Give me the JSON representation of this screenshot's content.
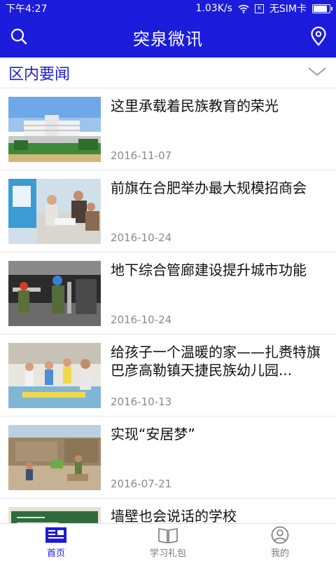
{
  "status_bar": {
    "time": "下午4:27",
    "speed": "1.03K/s",
    "sim": "无SIM卡",
    "sim_box": "×",
    "battery_level": 0.9
  },
  "app_bar": {
    "title": "突泉微讯",
    "left_icon": "search-icon",
    "right_icon": "location-icon"
  },
  "section": {
    "title": "区内要闻",
    "toggle_icon": "chevron-down-icon"
  },
  "news": [
    {
      "title": "这里承载着民族教育的荣光",
      "date": "2016-11-07"
    },
    {
      "title": "前旗在合肥举办最大规模招商会",
      "date": "2016-10-24"
    },
    {
      "title": "地下综合管廊建设提升城市功能",
      "date": "2016-10-24"
    },
    {
      "title": "给孩子一个温暖的家——扎赉特旗巴彦高勒镇天捷民族幼儿园...",
      "date": "2016-10-13"
    },
    {
      "title": "实现“安居梦”",
      "date": "2016-07-21"
    },
    {
      "title": "墙壁也会说话的学校",
      "date": ""
    }
  ],
  "tabs": [
    {
      "label": "首页",
      "icon": "news-icon",
      "active": true
    },
    {
      "label": "学习礼包",
      "icon": "book-icon",
      "active": false
    },
    {
      "label": "我的",
      "icon": "user-icon",
      "active": false
    }
  ],
  "colors": {
    "primary": "#1c1cdc",
    "date_gray": "#8a8a8a",
    "divider": "#e6e6e6"
  }
}
